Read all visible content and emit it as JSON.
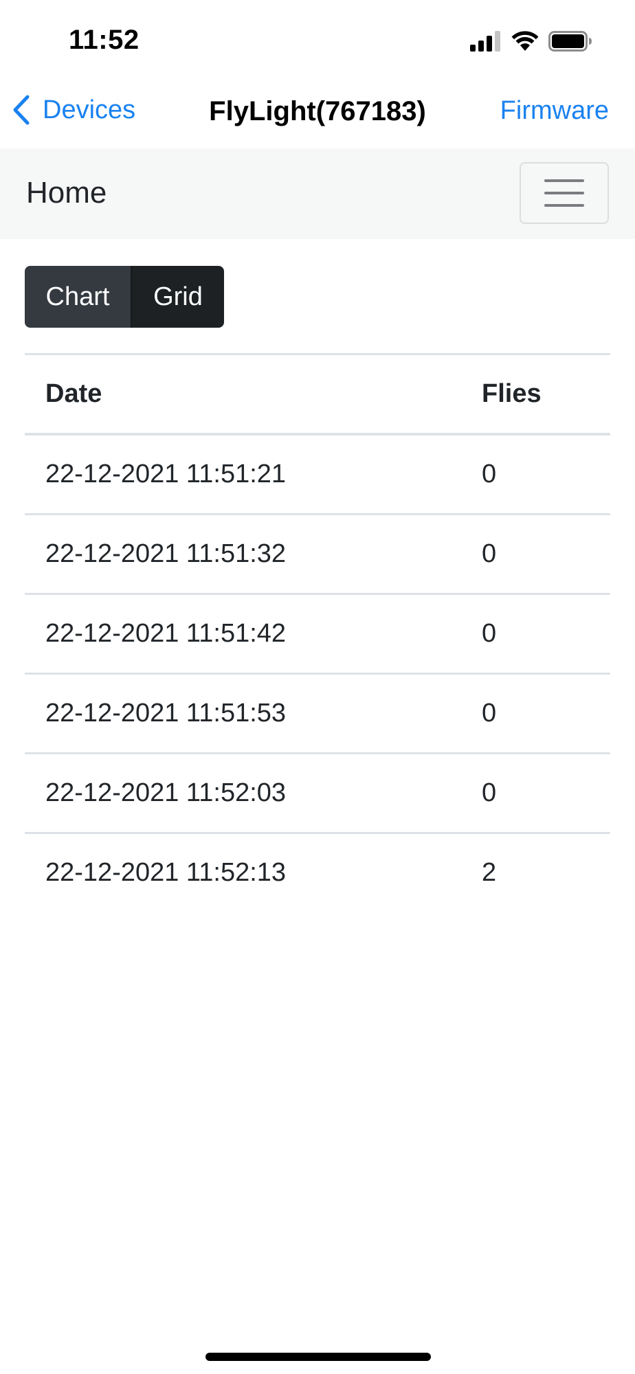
{
  "status_bar": {
    "time": "11:52",
    "icons": [
      "cellular-signal-icon",
      "wifi-icon",
      "battery-icon"
    ]
  },
  "nav": {
    "back_label": "Devices",
    "title": "FlyLight(767183)",
    "right_label": "Firmware",
    "accent_color": "#1a82f0"
  },
  "app_navbar": {
    "brand": "Home",
    "menu_icon": "hamburger-menu-icon"
  },
  "view_toggle": {
    "chart_label": "Chart",
    "grid_label": "Grid",
    "selected": "Grid"
  },
  "table": {
    "columns": [
      "Date",
      "Flies"
    ],
    "rows": [
      {
        "date": "22-12-2021 11:51:21",
        "flies": "0"
      },
      {
        "date": "22-12-2021 11:51:32",
        "flies": "0"
      },
      {
        "date": "22-12-2021 11:51:42",
        "flies": "0"
      },
      {
        "date": "22-12-2021 11:51:53",
        "flies": "0"
      },
      {
        "date": "22-12-2021 11:52:03",
        "flies": "0"
      },
      {
        "date": "22-12-2021 11:52:13",
        "flies": "2"
      }
    ]
  }
}
